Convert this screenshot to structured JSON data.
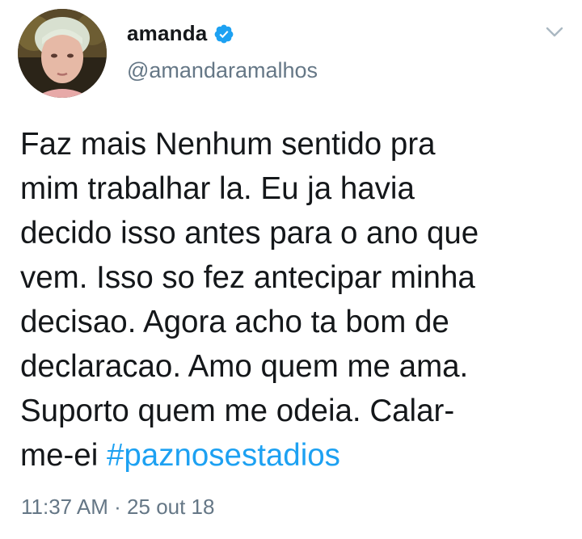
{
  "author": {
    "display_name": "amanda",
    "handle": "@amandaramalhos",
    "verified": true,
    "avatar_icon": "profile-photo",
    "verified_icon": "verified-badge-icon",
    "verified_color": "#1da1f2"
  },
  "tweet": {
    "lines": [
      "Faz mais Nenhum sentido pra",
      "mim trabalhar la. Eu ja havia",
      "decido isso antes para o ano que",
      "vem. Isso so fez antecipar minha",
      "decisao. Agora acho ta bom de",
      "declaracao. Amo quem me ama.",
      "Suporto quem me odeia. Calar-"
    ],
    "last_line_prefix": "me-ei ",
    "hashtag": "#paznosestadios",
    "hashtag_color": "#1da1f2"
  },
  "meta": {
    "time": "11:37 AM",
    "separator": " · ",
    "date": "25 out 18"
  },
  "menu": {
    "icon": "chevron-down-icon"
  }
}
